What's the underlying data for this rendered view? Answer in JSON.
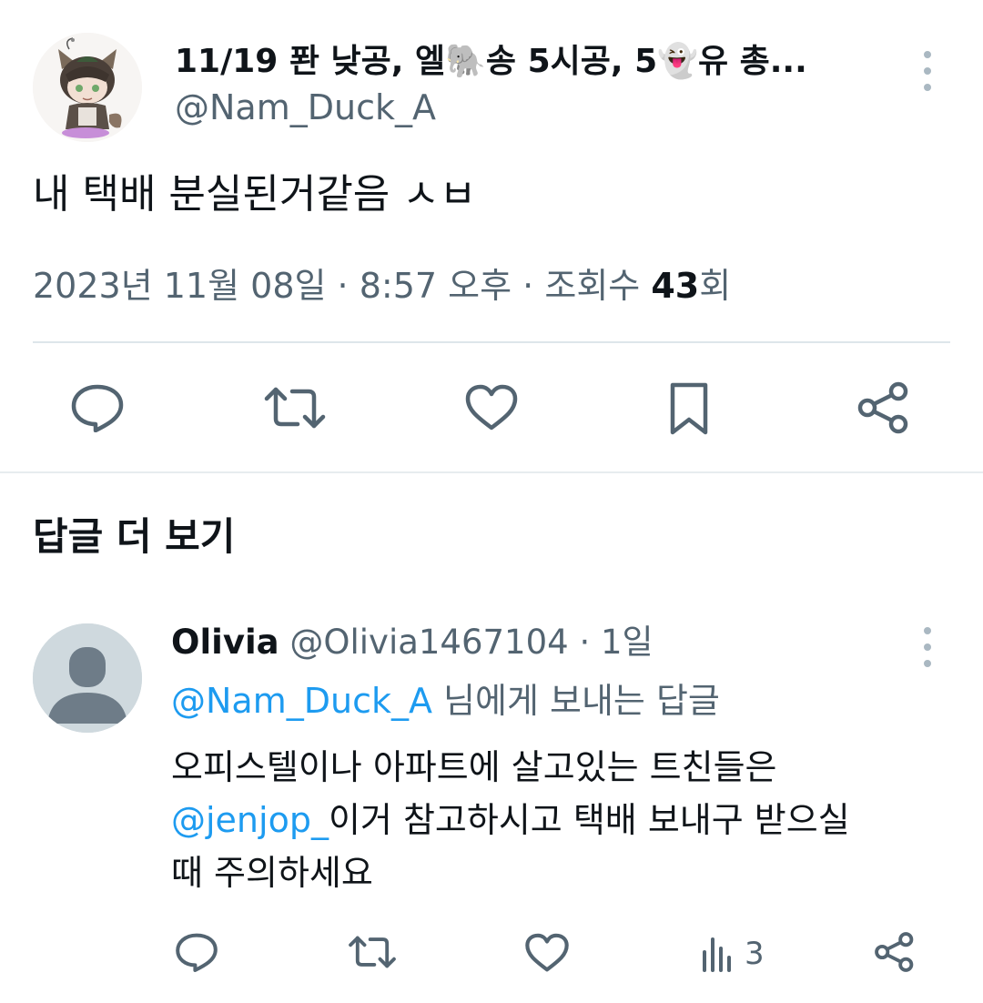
{
  "tweet": {
    "display_name": "11/19 퐌 낮공, 엘🐘송 5시공, 5👻유 총...",
    "handle": "@Nam_Duck_A",
    "text": "내 택배 분실된거같음 ㅅㅂ",
    "date": "2023년 11월 08일",
    "sep": "·",
    "time": "8:57 오후",
    "views_label": "조회수",
    "views_count": "43",
    "views_suffix": "회",
    "actions": [
      "reply-icon",
      "retweet-icon",
      "like-icon",
      "bookmark-icon",
      "share-icon"
    ]
  },
  "more_replies_title": "답글 더 보기",
  "reply": {
    "name": "Olivia",
    "handle": "@Olivia1467104",
    "sep": "·",
    "time_ago": "1일",
    "reply_to_handle": "@Nam_Duck_A",
    "reply_to_suffix": " 님에게 보내는 답글",
    "body_line1": "오피스텔이나 아파트에 살고있는 트친들은",
    "body_mention": "@jenjop_",
    "body_line2_rest": "이거 참고하시고 택배 보내구 받으실",
    "body_line3": "때 주의하세요",
    "views_count": "3",
    "actions": [
      "reply-icon",
      "retweet-icon",
      "like-icon",
      "views-icon",
      "share-icon"
    ]
  },
  "colors": {
    "accent_link": "#1d9bf0",
    "secondary_text": "#536471",
    "icon": "#536471",
    "divider": "#dde6ea"
  }
}
